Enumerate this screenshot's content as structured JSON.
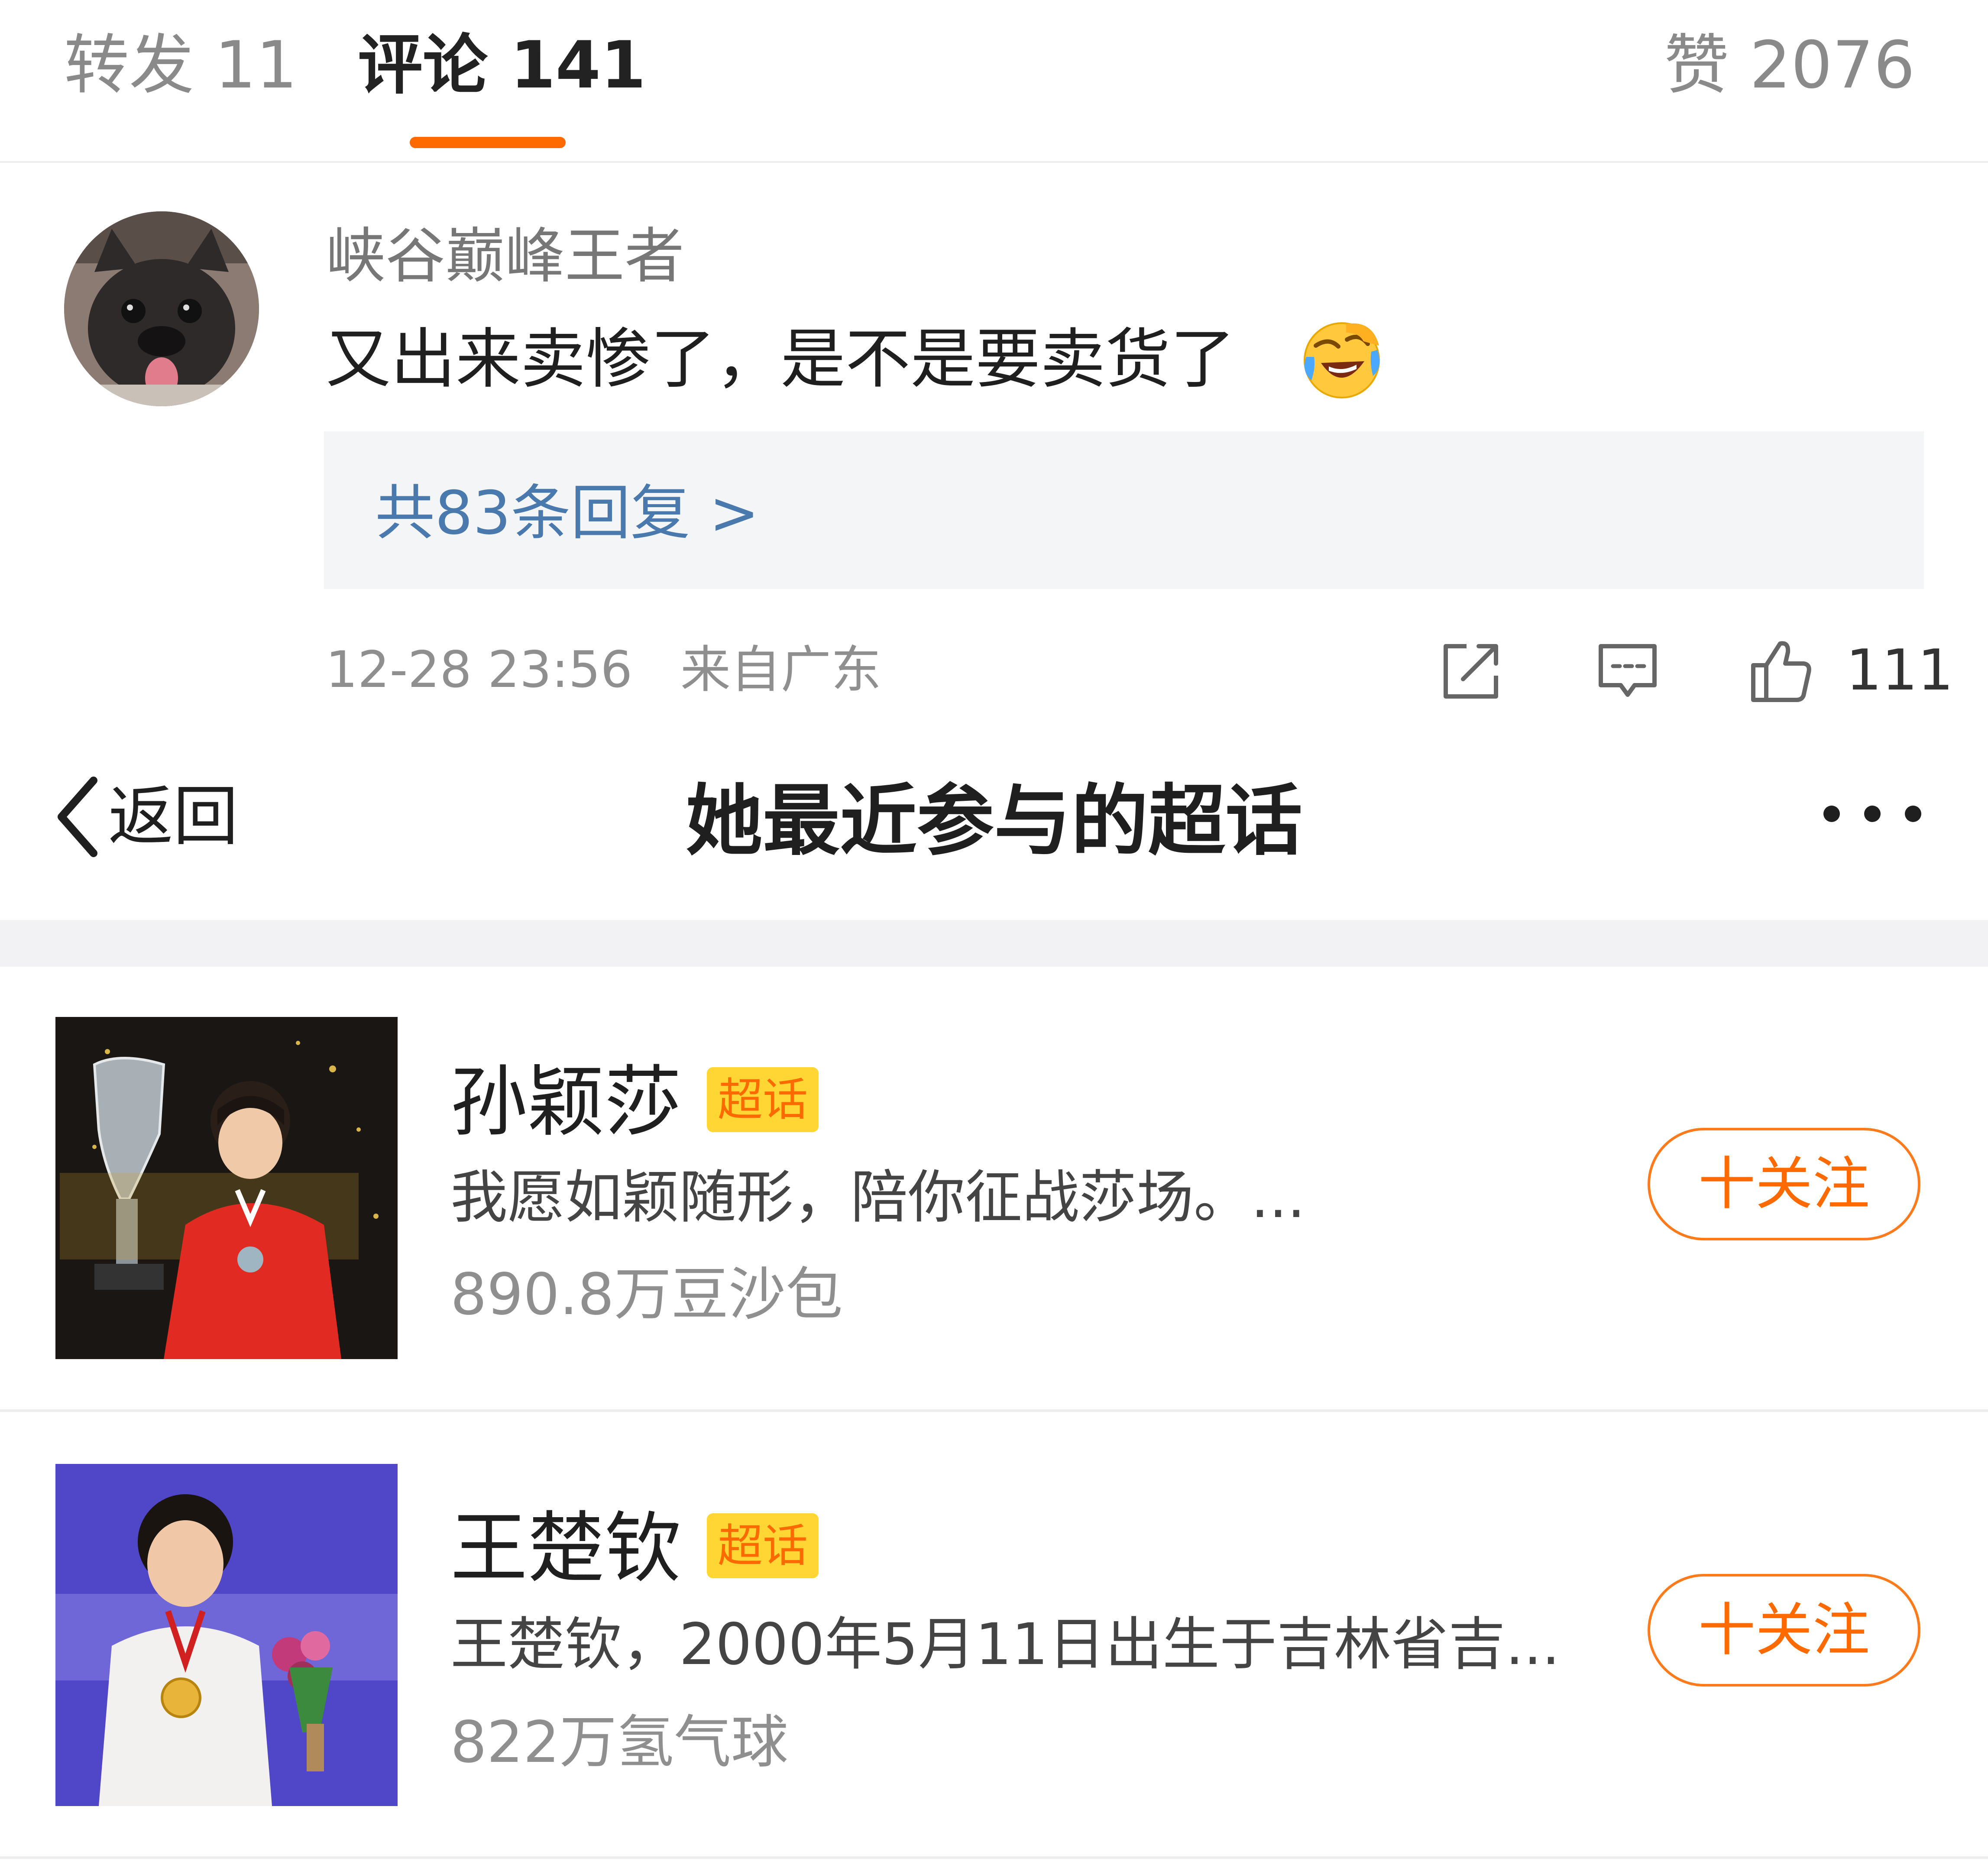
{
  "tabs": {
    "repost": "转发 11",
    "comment": "评论 141",
    "like": "赞 2076"
  },
  "comment": {
    "username": "峡谷巅峰王者",
    "text": "又出来卖惨了，是不是要卖货了",
    "emoji": "crying-laughing-emoji",
    "replies_link": "共83条回复 >",
    "timestamp": "12-28 23:56",
    "location": "来自广东",
    "like_count": "111"
  },
  "nav": {
    "back_label": "返回",
    "title": "她最近参与的超话"
  },
  "topics": [
    {
      "name": "孙颖莎",
      "badge": "超话",
      "description": "我愿如颖随形，陪你征战莎场。...",
      "stat": "890.8万豆沙包",
      "follow_label": "十关注"
    },
    {
      "name": "王楚钦",
      "badge": "超话",
      "description": "王楚钦，2000年5月11日出生于吉林省吉...",
      "stat": "822万氢气球",
      "follow_label": "十关注"
    }
  ],
  "colors": {
    "accent": "#ff6a00",
    "link": "#4a79ad",
    "badge_bg": "#ffd633"
  }
}
